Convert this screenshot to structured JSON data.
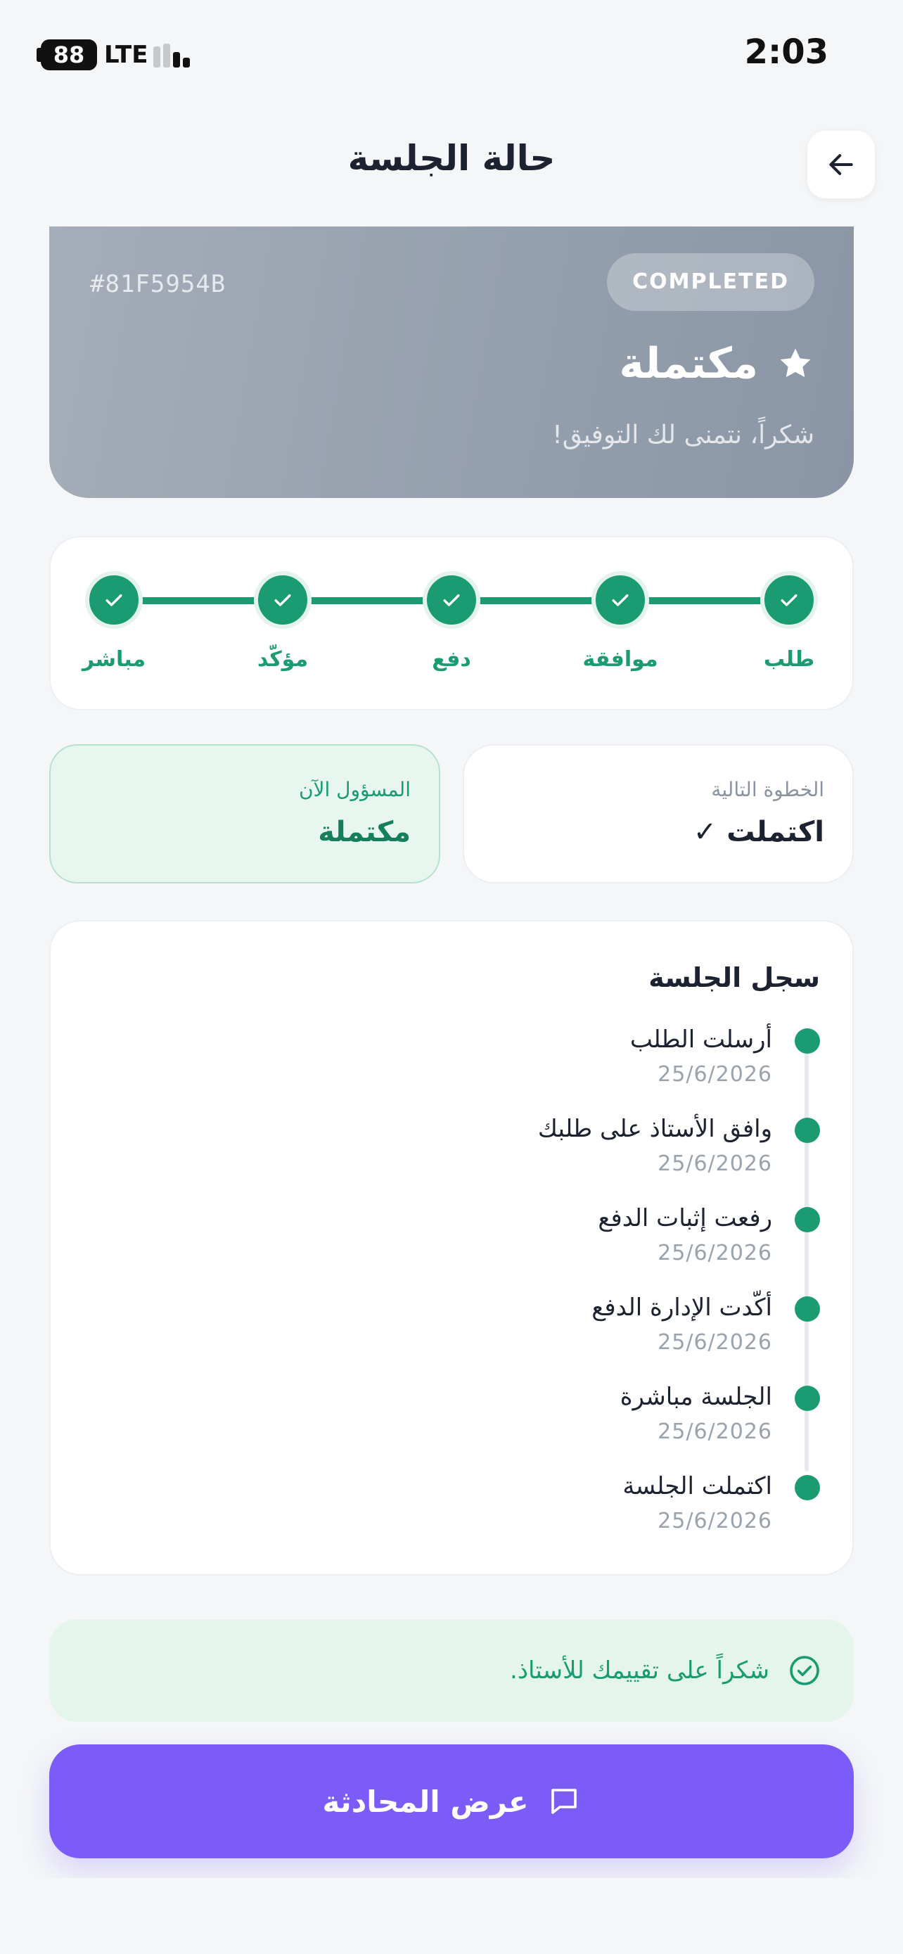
{
  "status_bar": {
    "battery": "88",
    "network": "LTE",
    "time": "2:03"
  },
  "header": {
    "title": "حالة الجلسة",
    "back_icon": "arrow-left-icon"
  },
  "session": {
    "id": "#81F5954B",
    "badge": "COMPLETED",
    "status": "مكتملة",
    "status_icon": "star-icon",
    "message": "شكراً، نتمنى لك التوفيق!"
  },
  "progress": {
    "steps": [
      {
        "label": "طلب"
      },
      {
        "label": "موافقة"
      },
      {
        "label": "دفع"
      },
      {
        "label": "مؤكّد"
      },
      {
        "label": "مباشر"
      }
    ],
    "completed_steps": 5,
    "color": "#1a9b72"
  },
  "info": {
    "next_step_label": "الخطوة التالية",
    "next_step_value": "اكتملت ✓",
    "owner_label": "المسؤول الآن",
    "owner_value": "مكتملة"
  },
  "timeline": {
    "title": "سجل الجلسة",
    "items": [
      {
        "text": "أرسلت الطلب",
        "date": "25/6/2026"
      },
      {
        "text": "وافق الأستاذ على طلبك",
        "date": "25/6/2026"
      },
      {
        "text": "رفعت إثبات الدفع",
        "date": "25/6/2026"
      },
      {
        "text": "أكّدت الإدارة الدفع",
        "date": "25/6/2026"
      },
      {
        "text": "الجلسة مباشرة",
        "date": "25/6/2026"
      },
      {
        "text": "اكتملت الجلسة",
        "date": "25/6/2026"
      }
    ]
  },
  "rating_notice": {
    "text": "شكراً على تقييمك للأستاذ.",
    "icon": "check-circle-icon"
  },
  "actions": {
    "view_chat": "عرض المحادثة",
    "chat_icon": "chat-bubble-icon"
  },
  "colors": {
    "accent_green": "#1a9b72",
    "primary_purple": "#7c5cf8"
  }
}
